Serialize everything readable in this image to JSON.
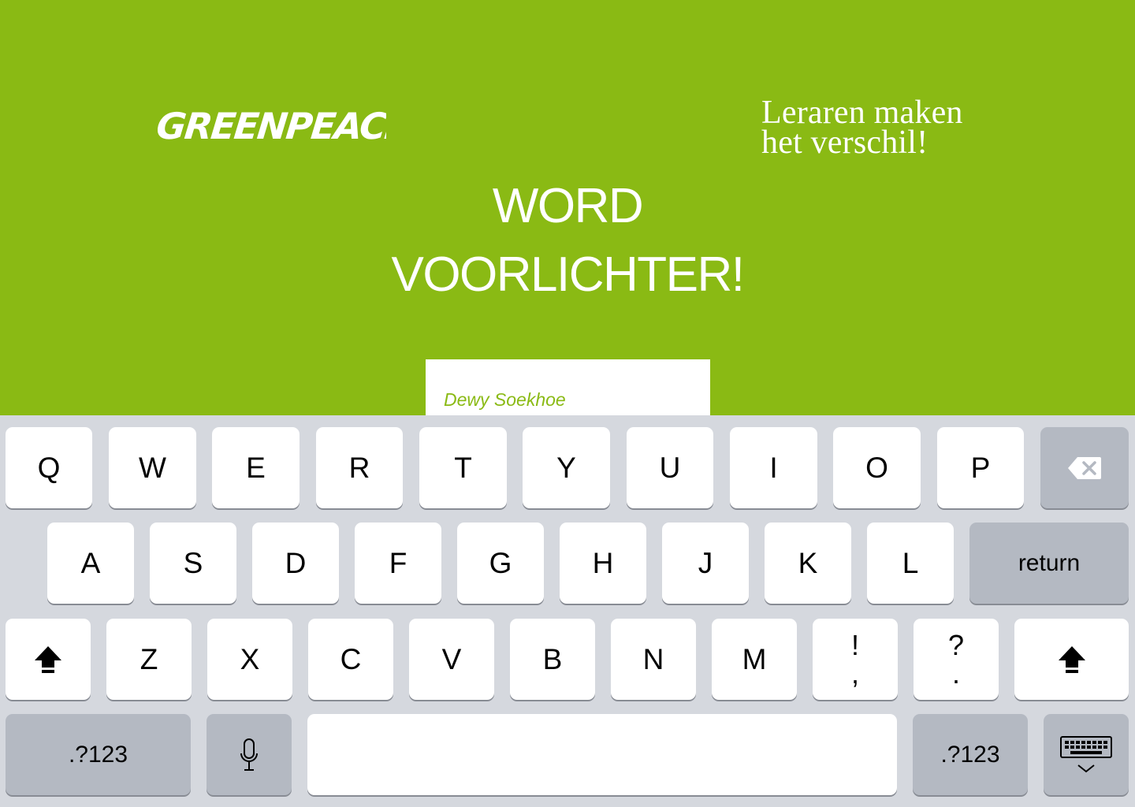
{
  "brand": {
    "logo_text": "GREENPEACE"
  },
  "tagline": {
    "line1": "Leraren maken",
    "line2": "het verschil!"
  },
  "headline": {
    "line1": "WORD",
    "line2": "VOORLICHTER!"
  },
  "name_field": {
    "placeholder": "Dewy Soekhoe",
    "value": ""
  },
  "colors": {
    "background": "#8aba14",
    "keyboard": "#d5d8de",
    "key": "#ffffff",
    "key_dark": "#b4b9c2"
  },
  "keyboard": {
    "row1": [
      "Q",
      "W",
      "E",
      "R",
      "T",
      "Y",
      "U",
      "I",
      "O",
      "P"
    ],
    "row2": [
      "A",
      "S",
      "D",
      "F",
      "G",
      "H",
      "J",
      "K",
      "L"
    ],
    "row3": [
      "Z",
      "X",
      "C",
      "V",
      "B",
      "N",
      "M"
    ],
    "exclaim_top": "!",
    "exclaim_bottom": ",",
    "question_top": "?",
    "question_bottom": ".",
    "return_label": "return",
    "numbers_left_label": ".?123",
    "numbers_right_label": ".?123",
    "icons": {
      "backspace": "backspace-icon",
      "shift": "shift-icon",
      "microphone": "microphone-icon",
      "hide_keyboard": "hide-keyboard-icon"
    }
  }
}
